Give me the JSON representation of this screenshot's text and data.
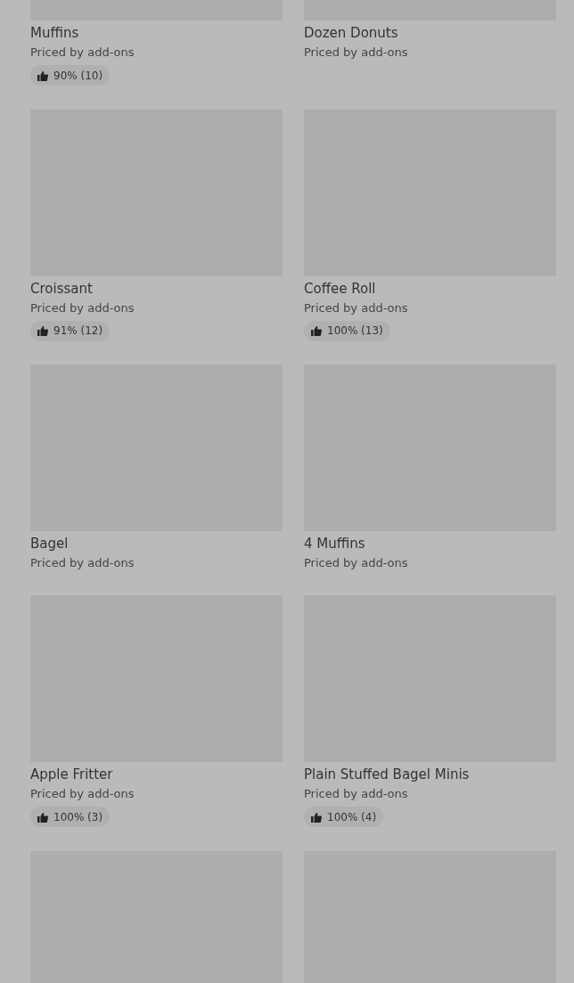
{
  "products": [
    {
      "kind": "product",
      "title": "Muffins",
      "subtitle": "Priced by add-ons",
      "rating": "90% (10)"
    },
    {
      "kind": "product",
      "title": "Dozen Donuts",
      "subtitle": "Priced by add-ons"
    },
    {
      "kind": "product",
      "title": "Croissant",
      "subtitle": "Priced by add-ons",
      "rating": "91% (12)"
    },
    {
      "kind": "product",
      "title": "Coffee Roll",
      "subtitle": "Priced by add-ons",
      "rating": "100% (13)"
    },
    {
      "kind": "product",
      "title": "Bagel",
      "subtitle": "Priced by add-ons"
    },
    {
      "kind": "product",
      "title": "4 Muffins",
      "subtitle": "Priced by add-ons"
    },
    {
      "kind": "product",
      "title": "Apple Fritter",
      "subtitle": "Priced by add-ons",
      "rating": "100% (3)"
    },
    {
      "kind": "product",
      "title": "Plain Stuffed Bagel Minis",
      "subtitle": "Priced by add-ons",
      "rating": "100% (4)"
    },
    {
      "kind": "picture"
    },
    {
      "kind": "picture"
    }
  ]
}
